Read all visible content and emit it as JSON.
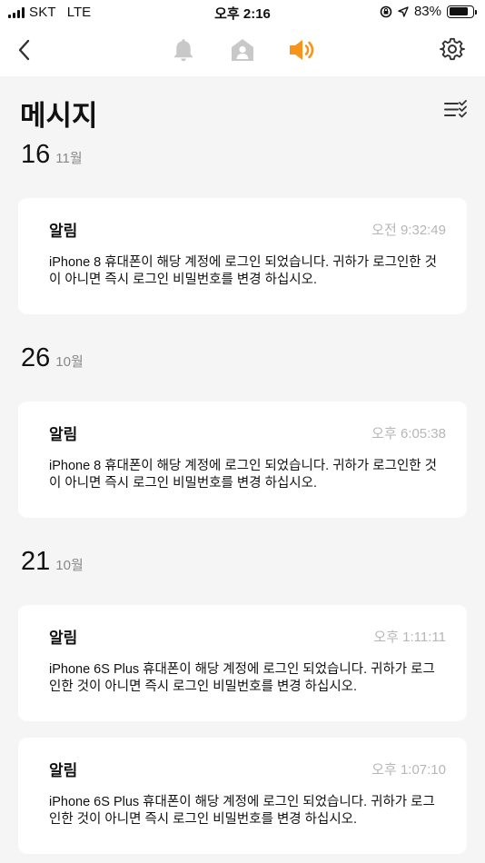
{
  "status_bar": {
    "carrier": "SKT",
    "network": "LTE",
    "time": "오후 2:16",
    "battery_percent": "83%",
    "battery_level": 0.83
  },
  "nav": {
    "icons": [
      "back-chevron-icon",
      "bell-icon",
      "home-user-icon",
      "speaker-icon",
      "gear-icon"
    ],
    "active_color": "#f7941d",
    "inactive_color": "#c8c8c8"
  },
  "page": {
    "title": "메시지"
  },
  "groups": [
    {
      "day": "16",
      "month": "11월",
      "messages": [
        {
          "title": "알림",
          "time": "오전 9:32:49",
          "body": "iPhone 8 휴대폰이 해당 계정에 로그인 되었습니다. 귀하가 로그인한 것이 아니면 즉시 로그인 비밀번호를 변경 하십시오."
        }
      ]
    },
    {
      "day": "26",
      "month": "10월",
      "messages": [
        {
          "title": "알림",
          "time": "오후 6:05:38",
          "body": "iPhone 8 휴대폰이 해당 계정에 로그인 되었습니다. 귀하가 로그인한 것이 아니면 즉시 로그인 비밀번호를 변경 하십시오."
        }
      ]
    },
    {
      "day": "21",
      "month": "10월",
      "messages": [
        {
          "title": "알림",
          "time": "오후 1:11:11",
          "body": "iPhone 6S Plus 휴대폰이 해당 계정에 로그인 되었습니다. 귀하가 로그인한 것이 아니면 즉시 로그인 비밀번호를 변경 하십시오."
        },
        {
          "title": "알림",
          "time": "오후 1:07:10",
          "body": "iPhone 6S Plus 휴대폰이 해당 계정에 로그인 되었습니다. 귀하가 로그인한 것이 아니면 즉시 로그인 비밀번호를 변경 하십시오."
        }
      ]
    }
  ]
}
